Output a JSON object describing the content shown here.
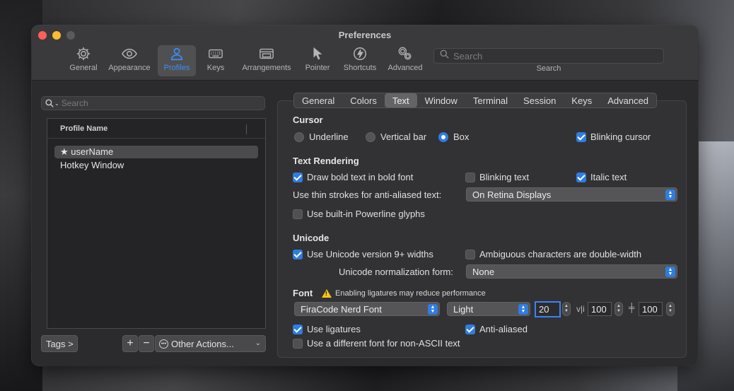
{
  "window": {
    "title": "Preferences"
  },
  "toolbar": {
    "items": [
      {
        "label": "General",
        "icon": "gear-icon"
      },
      {
        "label": "Appearance",
        "icon": "eye-icon"
      },
      {
        "label": "Profiles",
        "icon": "person-icon"
      },
      {
        "label": "Keys",
        "icon": "keyboard-icon"
      },
      {
        "label": "Arrangements",
        "icon": "windows-icon"
      },
      {
        "label": "Pointer",
        "icon": "pointer-icon"
      },
      {
        "label": "Shortcuts",
        "icon": "bolt-icon"
      },
      {
        "label": "Advanced",
        "icon": "gears-icon"
      }
    ],
    "active": "Profiles",
    "search_placeholder": "Search",
    "search_label": "Search"
  },
  "profiles": {
    "search_placeholder": "Search",
    "column_header": "Profile Name",
    "items": [
      {
        "name": "★ userName",
        "selected": true
      },
      {
        "name": "Hotkey Window",
        "selected": false
      }
    ],
    "tags_label": "Tags >",
    "add_label": "+",
    "remove_label": "−",
    "other_actions_label": "Other Actions..."
  },
  "tabs": [
    "General",
    "Colors",
    "Text",
    "Window",
    "Terminal",
    "Session",
    "Keys",
    "Advanced"
  ],
  "active_tab": "Text",
  "cursor": {
    "heading": "Cursor",
    "options": [
      "Underline",
      "Vertical bar",
      "Box"
    ],
    "selected": "Box",
    "blinking_label": "Blinking cursor",
    "blinking": true
  },
  "text_rendering": {
    "heading": "Text Rendering",
    "bold_label": "Draw bold text in bold font",
    "bold": true,
    "blinking_text_label": "Blinking text",
    "blinking_text": false,
    "italic_label": "Italic text",
    "italic": true,
    "thin_strokes_label": "Use thin strokes for anti-aliased text:",
    "thin_strokes_value": "On Retina Displays",
    "powerline_label": "Use built-in Powerline glyphs",
    "powerline": false
  },
  "unicode": {
    "heading": "Unicode",
    "version_label": "Use Unicode version 9+ widths",
    "version": true,
    "ambiguous_label": "Ambiguous characters are double-width",
    "ambiguous": false,
    "normalization_label": "Unicode normalization form:",
    "normalization_value": "None"
  },
  "font": {
    "heading": "Font",
    "warning": "Enabling ligatures may reduce performance",
    "family": "FiraCode Nerd Font",
    "weight": "Light",
    "size": "20",
    "h_spacing": "100",
    "v_spacing": "100",
    "h_spacing_icon": "v|i",
    "v_spacing_icon": "╪",
    "ligatures_label": "Use ligatures",
    "ligatures": true,
    "antialiased_label": "Anti-aliased",
    "antialiased": true,
    "non_ascii_label": "Use a different font for non-ASCII text",
    "non_ascii": false
  },
  "colors": {
    "accent": "#2f7de1",
    "close": "#fe5f57",
    "minimize": "#febc2e",
    "warning": "#f5c518"
  }
}
